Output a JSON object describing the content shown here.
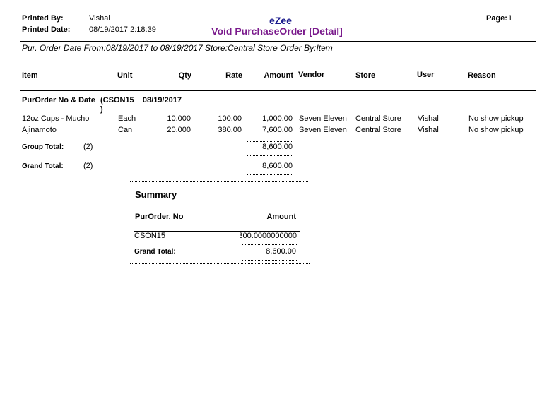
{
  "header": {
    "printed_by_label": "Printed By:",
    "printed_by_value": "Vishal",
    "printed_date_label": "Printed Date:",
    "printed_date_value": "08/19/2017 2:18:39",
    "company": "eZee",
    "report_title": "Void PurchaseOrder [Detail]",
    "page_label": "Page:",
    "page_value": "1",
    "filter_text": "Pur. Order Date From:08/19/2017 to 08/19/2017  Store:Central Store  Order By:Item"
  },
  "columns": {
    "item": "Item",
    "unit": "Unit",
    "qty": "Qty",
    "rate": "Rate",
    "amount": "Amount",
    "vendor": "Vendor",
    "store": "Store",
    "user": "User",
    "reason": "Reason"
  },
  "group": {
    "label": "PurOrder No & Date",
    "value_line1": "(CSON15    08/19/2017",
    "value_line2": ")"
  },
  "rows": [
    {
      "item": "12oz Cups - Mucho",
      "unit": "Each",
      "qty": "10.000",
      "rate": "100.00",
      "amount": "1,000.00",
      "vendor": "Seven Eleven",
      "store": "Central Store",
      "user": "Vishal",
      "reason": "No show pickup"
    },
    {
      "item": "Ajinamoto",
      "unit": "Can",
      "qty": "20.000",
      "rate": "380.00",
      "amount": "7,600.00",
      "vendor": "Seven Eleven",
      "store": "Central Store",
      "user": "Vishal",
      "reason": "No show pickup"
    }
  ],
  "totals": {
    "group_total_label": "Group Total:",
    "group_total_count": "(2)",
    "group_total_amount": "8,600.00",
    "grand_total_label": "Grand Total:",
    "grand_total_count": "(2)",
    "grand_total_amount": "8,600.00"
  },
  "summary": {
    "title": "Summary",
    "col_no": "PurOrder. No",
    "col_amount": "Amount",
    "row_no": "CSON15",
    "row_amount": "300.0000000000",
    "grand_total_label": "Grand Total:",
    "grand_total_amount": "8,600.00"
  }
}
